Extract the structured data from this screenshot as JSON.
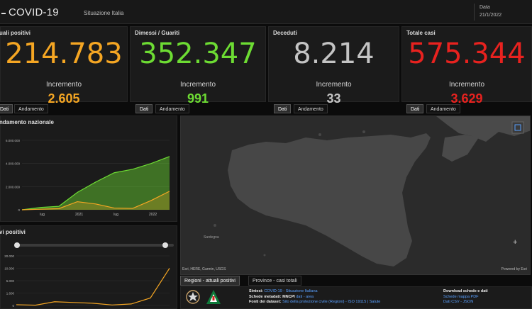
{
  "header": {
    "title": "COVID-19",
    "subtitle": "Situazione Italia",
    "date_label": "Data",
    "date_value": "21/1/2022"
  },
  "kpis": [
    {
      "label": "uali positivi",
      "value": "214.783",
      "increment_label": "Incremento",
      "increment": "2.605",
      "color": "#f5a623"
    },
    {
      "label": "Dimessi / Guariti",
      "value": "352.347",
      "increment_label": "Incremento",
      "increment": "991",
      "color": "#6ddc33"
    },
    {
      "label": "Deceduti",
      "value": "8.214",
      "increment_label": "Incremento",
      "increment": "33",
      "color": "#c4c4c4"
    },
    {
      "label": "Totale casi",
      "value": "575.344",
      "increment_label": "Incremento",
      "increment": "3.629",
      "color": "#e8221f"
    }
  ],
  "kpi_tabs": {
    "dati": "Dati",
    "andamento": "Andamento",
    "dati_cut": "Dati"
  },
  "chart_data": [
    {
      "type": "area",
      "title": "ndamento nazionale",
      "x_tick_labels": [
        "lug",
        "2021",
        "lug",
        "2022"
      ],
      "y_tick_labels": [
        "6.000.000",
        "4.000.000",
        "2.000.000",
        "0"
      ],
      "ylim": [
        0,
        6000000
      ],
      "grid": true,
      "x": [
        "2020-03",
        "2020-06",
        "2020-09",
        "2020-12",
        "2021-03",
        "2021-06",
        "2021-09",
        "2021-12",
        "2022-01"
      ],
      "series": [
        {
          "values": [
            0,
            200000,
            300000,
            1500000,
            2400000,
            3200000,
            3500000,
            4000000,
            4600000
          ],
          "color": "#6ddc33"
        },
        {
          "values": [
            0,
            50000,
            100000,
            700000,
            500000,
            150000,
            120000,
            800000,
            1600000
          ],
          "color": "#f5a623"
        }
      ]
    },
    {
      "type": "line",
      "title": "vi positivi",
      "y_tick_labels": [
        "20.000",
        "10.000",
        "5.000",
        "1.600",
        "0"
      ],
      "ylim": [
        0,
        20000
      ],
      "grid": true,
      "x": [
        "2020-03",
        "2020-06",
        "2020-09",
        "2020-12",
        "2021-03",
        "2021-06",
        "2021-09",
        "2021-12",
        "2022-01"
      ],
      "series": [
        {
          "values": [
            300,
            100,
            1500,
            1200,
            900,
            200,
            600,
            3000,
            15000
          ],
          "color": "#f5a623"
        }
      ]
    }
  ],
  "map": {
    "attribution_left": "Esri, HERE, Garmin, USGS",
    "attribution_right": "Powered by Esri",
    "label_sardinia": "Sardegna",
    "zoom_in": "+"
  },
  "bottom_tabs": [
    "Regioni - attuali positivi",
    "Province - casi totali"
  ],
  "info": {
    "line1_label": "Sintesi:",
    "line1_value": "COVID-19 - Situazione Italiana",
    "line2_label": "Schede metadati: MNCPI",
    "line2_value": "dati - area",
    "line3_label": "Fonti dei dataset:",
    "line3_value": "Sito della protezione civile (Regioni) - ISO 19115 | Salute",
    "download_title": "Download schede e dati",
    "download_1": "Schede mappa PDF",
    "download_2": "Dati CSV - JSON"
  }
}
